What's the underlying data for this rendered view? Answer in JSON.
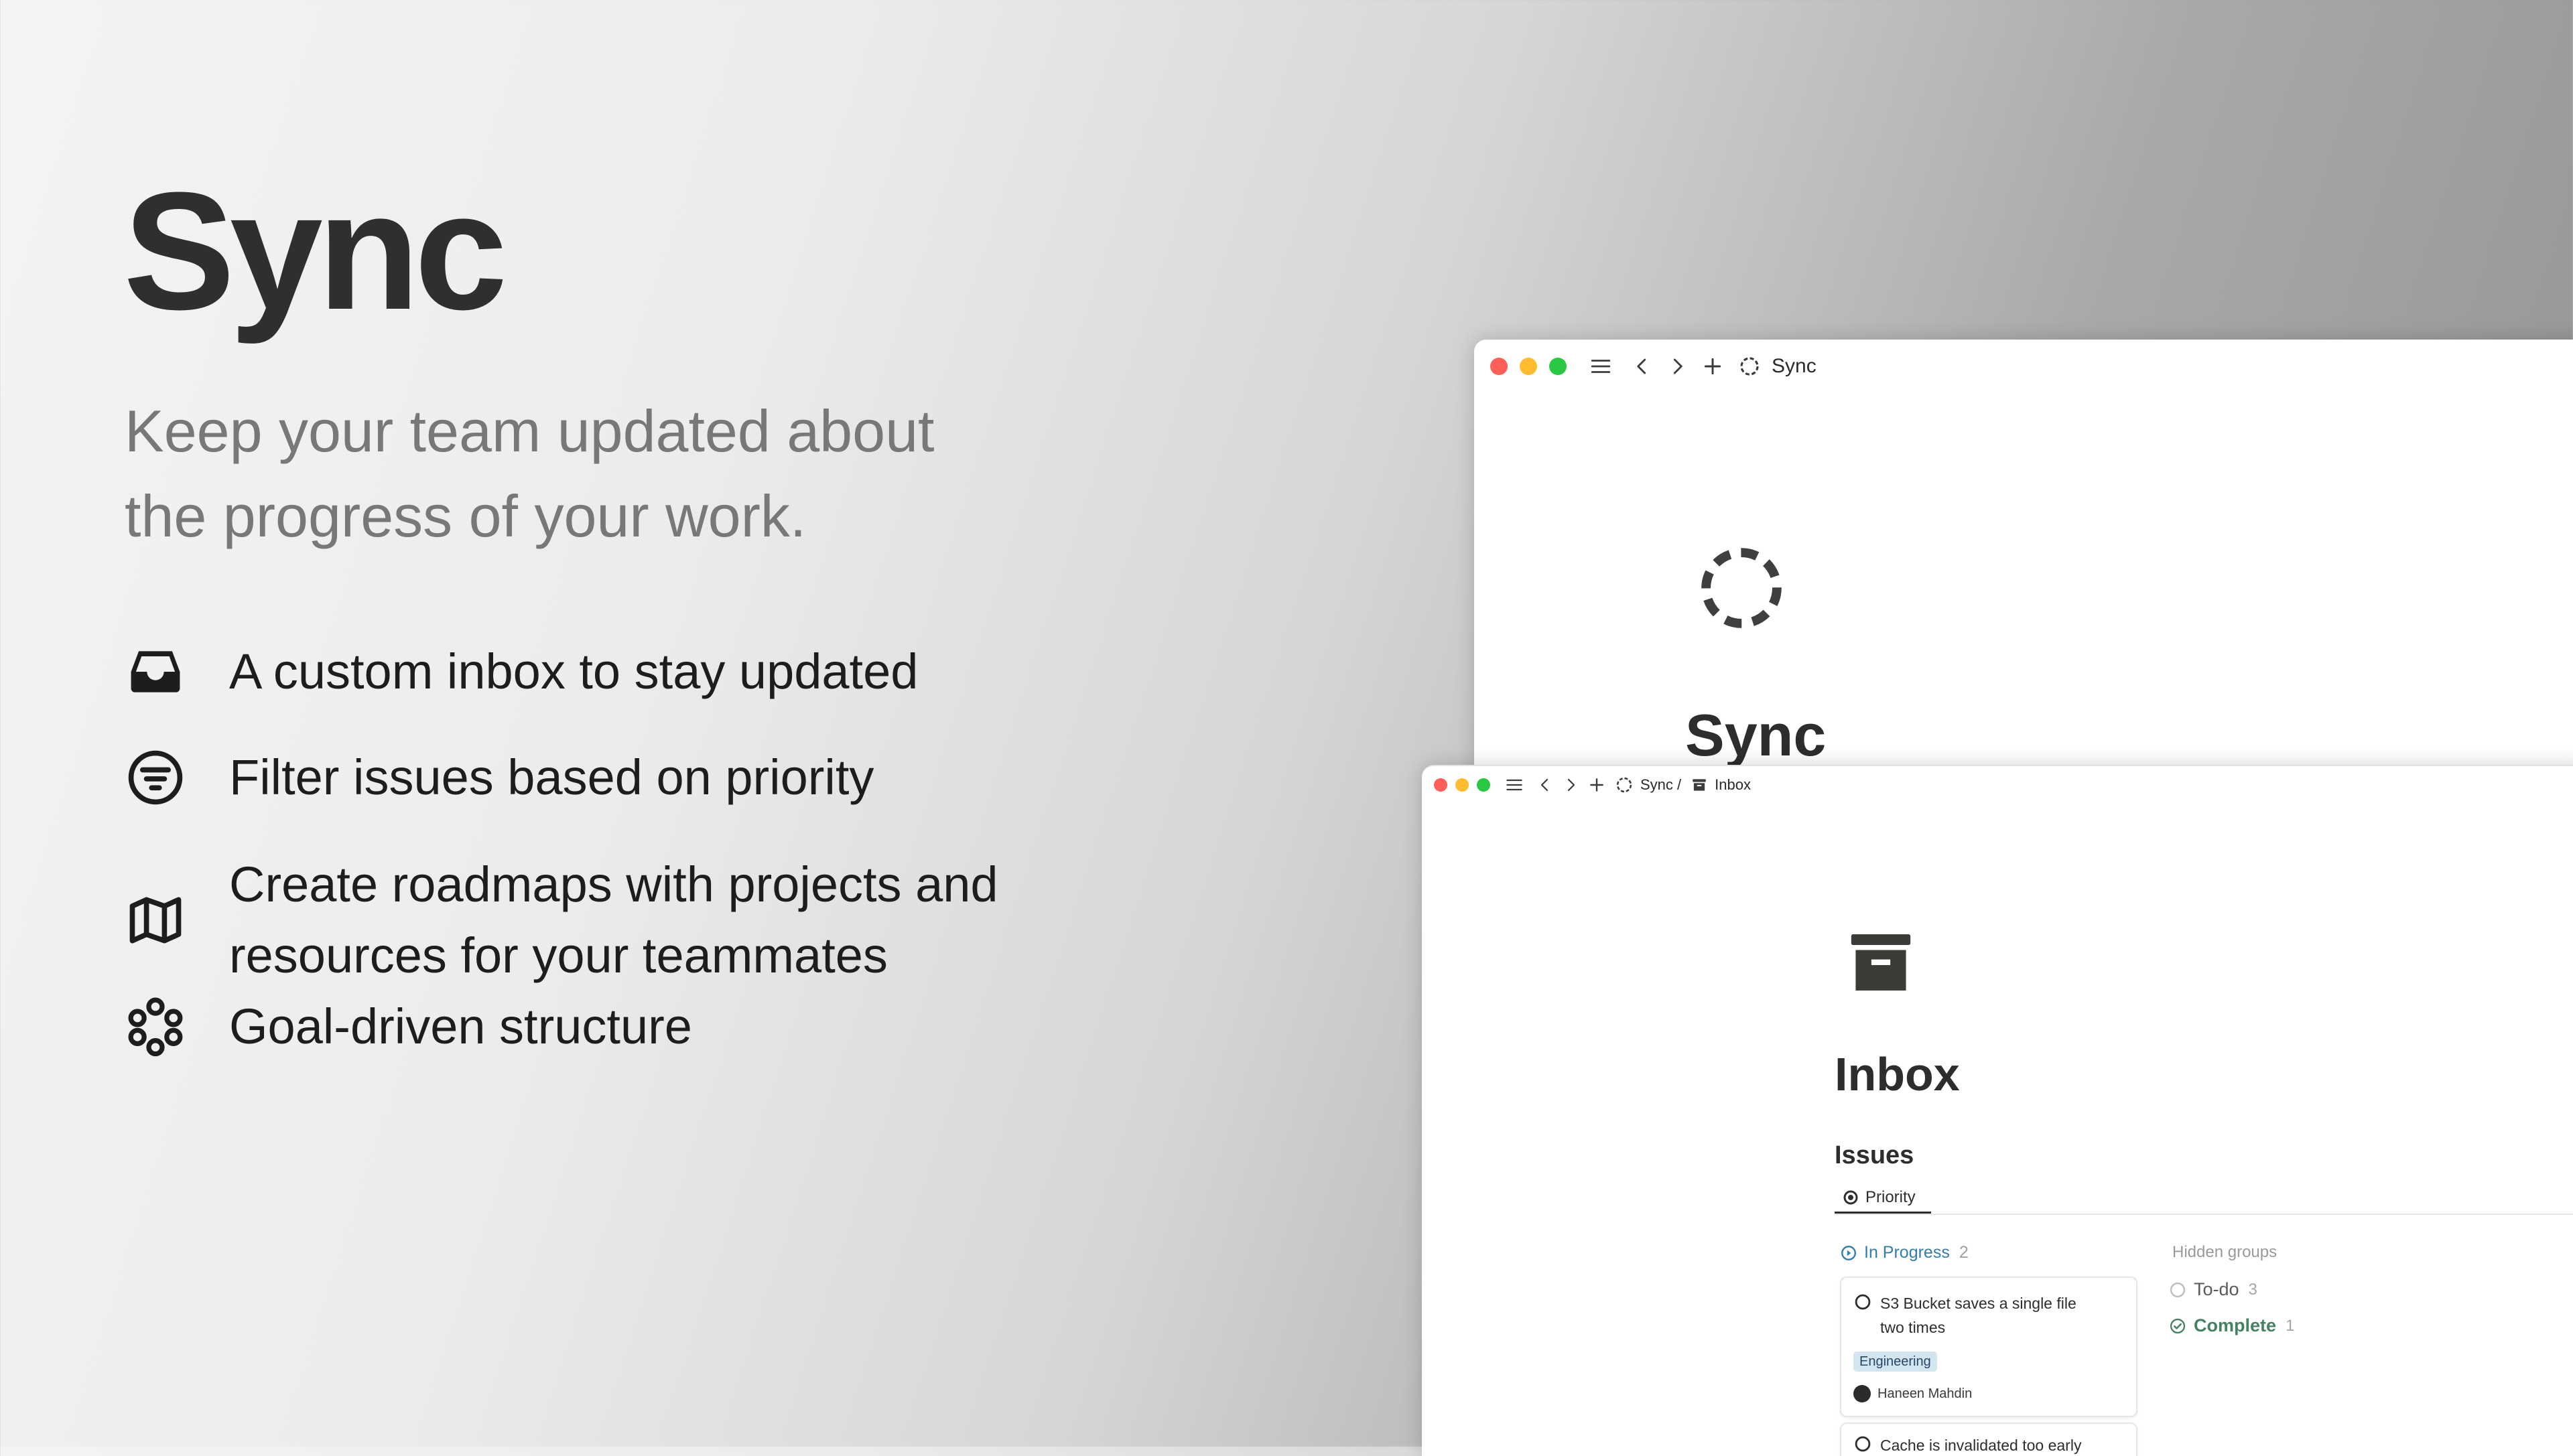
{
  "hero": {
    "title": "Sync",
    "subtitle_line1": "Keep your team updated about",
    "subtitle_line2": "the progress of your work."
  },
  "features": [
    {
      "icon": "inbox-tray-icon",
      "line1": "A custom inbox to stay updated",
      "line2": ""
    },
    {
      "icon": "filter-circle-icon",
      "line1": "Filter issues based on priority",
      "line2": ""
    },
    {
      "icon": "map-icon",
      "line1": "Create roadmaps with projects and",
      "line2": "resources for your teammates"
    },
    {
      "icon": "goal-circles-icon",
      "line1": "Goal-driven structure",
      "line2": ""
    }
  ],
  "window_back": {
    "breadcrumb": "Sync",
    "page_title": "Sync"
  },
  "window_front": {
    "breadcrumb_parent": "Sync /",
    "breadcrumb_current": "Inbox",
    "page_title": "Inbox",
    "section_title": "Issues",
    "view_tab": "Priority",
    "group_in_progress": {
      "label": "In Progress",
      "count": "2"
    },
    "hidden_groups_label": "Hidden groups",
    "hidden_groups": [
      {
        "label": "To-do",
        "count": "3"
      },
      {
        "label": "Complete",
        "count": "1"
      }
    ],
    "cards": [
      {
        "title_line1": "S3 Bucket saves a single file",
        "title_line2": "two times",
        "tag": "Engineering",
        "assignee": "Haneen Mahdin"
      },
      {
        "title_line1": "Cache is invalidated too early",
        "title_line2": "",
        "tag": "",
        "assignee": ""
      }
    ]
  },
  "colors": {
    "close": "#ff5f57",
    "minimize": "#febc2e",
    "zoom": "#28c840",
    "in_progress_blue": "#337ea9",
    "complete_green": "#448361",
    "tag_bg": "#d3e5ef",
    "tag_text": "#28456c"
  }
}
